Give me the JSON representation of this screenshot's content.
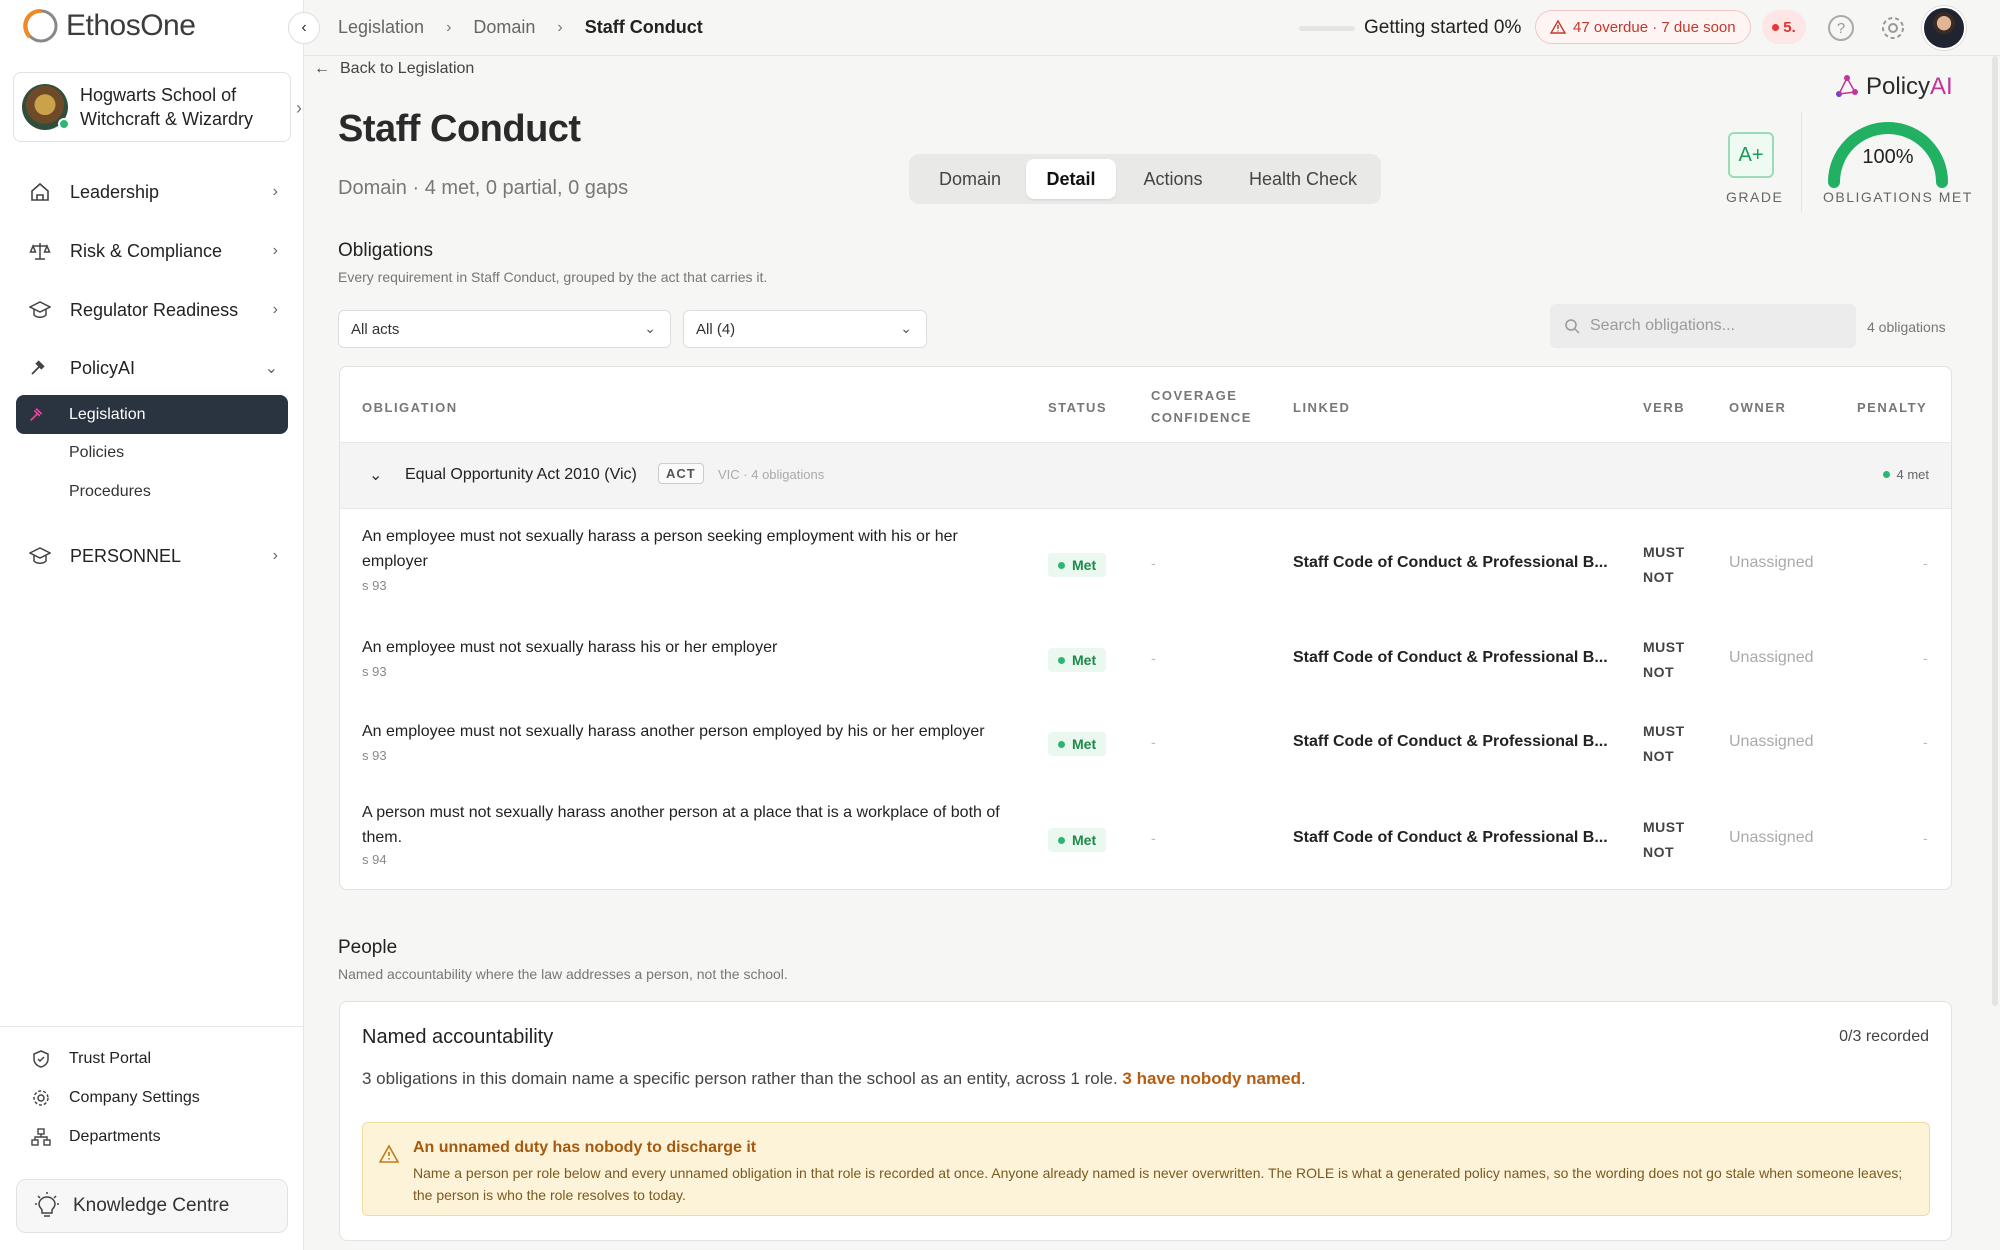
{
  "app": {
    "brand": "EthosOne",
    "accent": "#2a3340",
    "ai_pink": "#c2359b"
  },
  "org": {
    "name_line1": "Hogwarts School of",
    "name_line2": "Witchcraft & Wizardry"
  },
  "nav": {
    "items": [
      {
        "label": "Leadership",
        "icon": "home-icon"
      },
      {
        "label": "Risk & Compliance",
        "icon": "scale-icon"
      },
      {
        "label": "Regulator Readiness",
        "icon": "graduation-cap-icon"
      },
      {
        "label": "PolicyAI",
        "icon": "gavel-icon"
      },
      {
        "label": "PERSONNEL",
        "icon": "graduation-cap-icon"
      }
    ],
    "active": "Legislation",
    "sub_items": [
      "Policies",
      "Procedures"
    ],
    "bottom": [
      "Trust Portal",
      "Company Settings",
      "Departments"
    ],
    "knowledge": "Knowledge Centre"
  },
  "breadcrumb": [
    "Legislation",
    "Domain",
    "Staff Conduct"
  ],
  "topbar": {
    "getting_started": "Getting started 0%",
    "overdue": "47 overdue · 7 due soon",
    "red_count": "5."
  },
  "page": {
    "back": "Back to Legislation",
    "title": "Staff Conduct",
    "subtitle": "Domain · 4 met, 0 partial, 0 gaps",
    "tabs": [
      "Domain",
      "Detail",
      "Actions",
      "Health Check"
    ],
    "active_tab": "Detail"
  },
  "policyai": {
    "brand_p": "Policy",
    "brand_ai": "AI",
    "grade": "A+",
    "grade_label": "GRADE",
    "gauge_value": "100%",
    "gauge_fraction": 1.0,
    "gauge_label": "OBLIGATIONS MET"
  },
  "obligations": {
    "title": "Obligations",
    "desc": "Every requirement in Staff Conduct, grouped by the act that carries it.",
    "filter_acts": "All acts",
    "filter_status": "All (4)",
    "search_placeholder": "Search obligations...",
    "count": "4 obligations",
    "columns": {
      "obligation": "OBLIGATION",
      "status": "STATUS",
      "coverage_1": "COVERAGE",
      "coverage_2": "CONFIDENCE",
      "linked": "LINKED",
      "verb": "VERB",
      "owner": "OWNER",
      "penalty": "PENALTY"
    },
    "group": {
      "name": "Equal Opportunity Act 2010 (Vic)",
      "tag": "ACT",
      "meta": "VIC · 4 obligations",
      "met": "4 met"
    },
    "rows": [
      {
        "text": "An employee must not sexually harass a person seeking employment with his or her employer",
        "section": "s 93",
        "status": "Met",
        "coverage": "-",
        "linked": "Staff Code of Conduct & Professional B...",
        "verb1": "MUST",
        "verb2": "NOT",
        "owner": "Unassigned",
        "penalty": "-"
      },
      {
        "text": "An employee must not sexually harass his or her employer",
        "section": "s 93",
        "status": "Met",
        "coverage": "-",
        "linked": "Staff Code of Conduct & Professional B...",
        "verb1": "MUST",
        "verb2": "NOT",
        "owner": "Unassigned",
        "penalty": "-"
      },
      {
        "text": "An employee must not sexually harass another person employed by his or her employer",
        "section": "s 93",
        "status": "Met",
        "coverage": "-",
        "linked": "Staff Code of Conduct & Professional B...",
        "verb1": "MUST",
        "verb2": "NOT",
        "owner": "Unassigned",
        "penalty": "-"
      },
      {
        "text": "A person must not sexually harass another person at a place that is a workplace of both of them.",
        "section": "s 94",
        "status": "Met",
        "coverage": "-",
        "linked": "Staff Code of Conduct & Professional B...",
        "verb1": "MUST",
        "verb2": "NOT",
        "owner": "Unassigned",
        "penalty": "-"
      }
    ]
  },
  "people": {
    "title": "People",
    "desc": "Named accountability where the law addresses a person, not the school.",
    "card_title": "Named accountability",
    "recorded": "0/3 recorded",
    "text": "3 obligations in this domain name a specific person rather than the school as an entity, across 1 role.",
    "highlight": "3 have nobody named",
    "warn_title": "An unnamed duty has nobody to discharge it",
    "warn_body": "Name a person per role below and every unnamed obligation in that role is recorded at once. Anyone already named is never overwritten. The ROLE is what a generated policy names, so the wording does not go stale when someone leaves; the person is who the role resolves to today."
  }
}
